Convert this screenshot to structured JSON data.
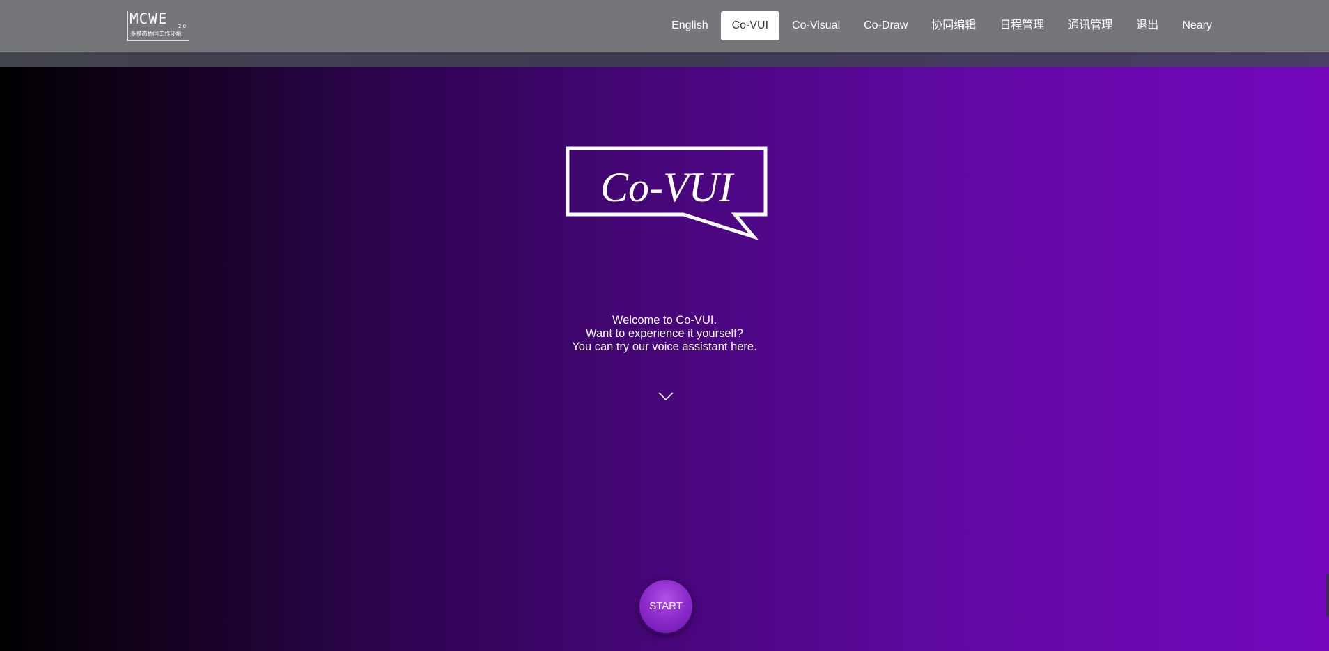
{
  "nav": {
    "items": [
      {
        "label": "English"
      },
      {
        "label": "Co-VUI",
        "active": true
      },
      {
        "label": "Co-Visual"
      },
      {
        "label": "Co-Draw"
      },
      {
        "label": "协同编辑"
      },
      {
        "label": "日程管理"
      },
      {
        "label": "通讯管理"
      },
      {
        "label": "退出"
      },
      {
        "label": "Neary"
      }
    ],
    "logo": {
      "main": "MCWE",
      "version": "2.0",
      "subtitle": "多模态协同工作环境"
    }
  },
  "hero": {
    "logo_text": "Co-VUI",
    "welcome_lines": [
      "Welcome to Co-VUI.",
      "Want to experience it yourself?",
      "You can try our voice assistant here."
    ],
    "scroll_icon": "chevron-down-icon",
    "start_label": "START"
  },
  "colors": {
    "navbar": "#747679",
    "gradient_start": "#000000",
    "gradient_end": "#7407bd",
    "start_button": "#8f2dcf"
  }
}
